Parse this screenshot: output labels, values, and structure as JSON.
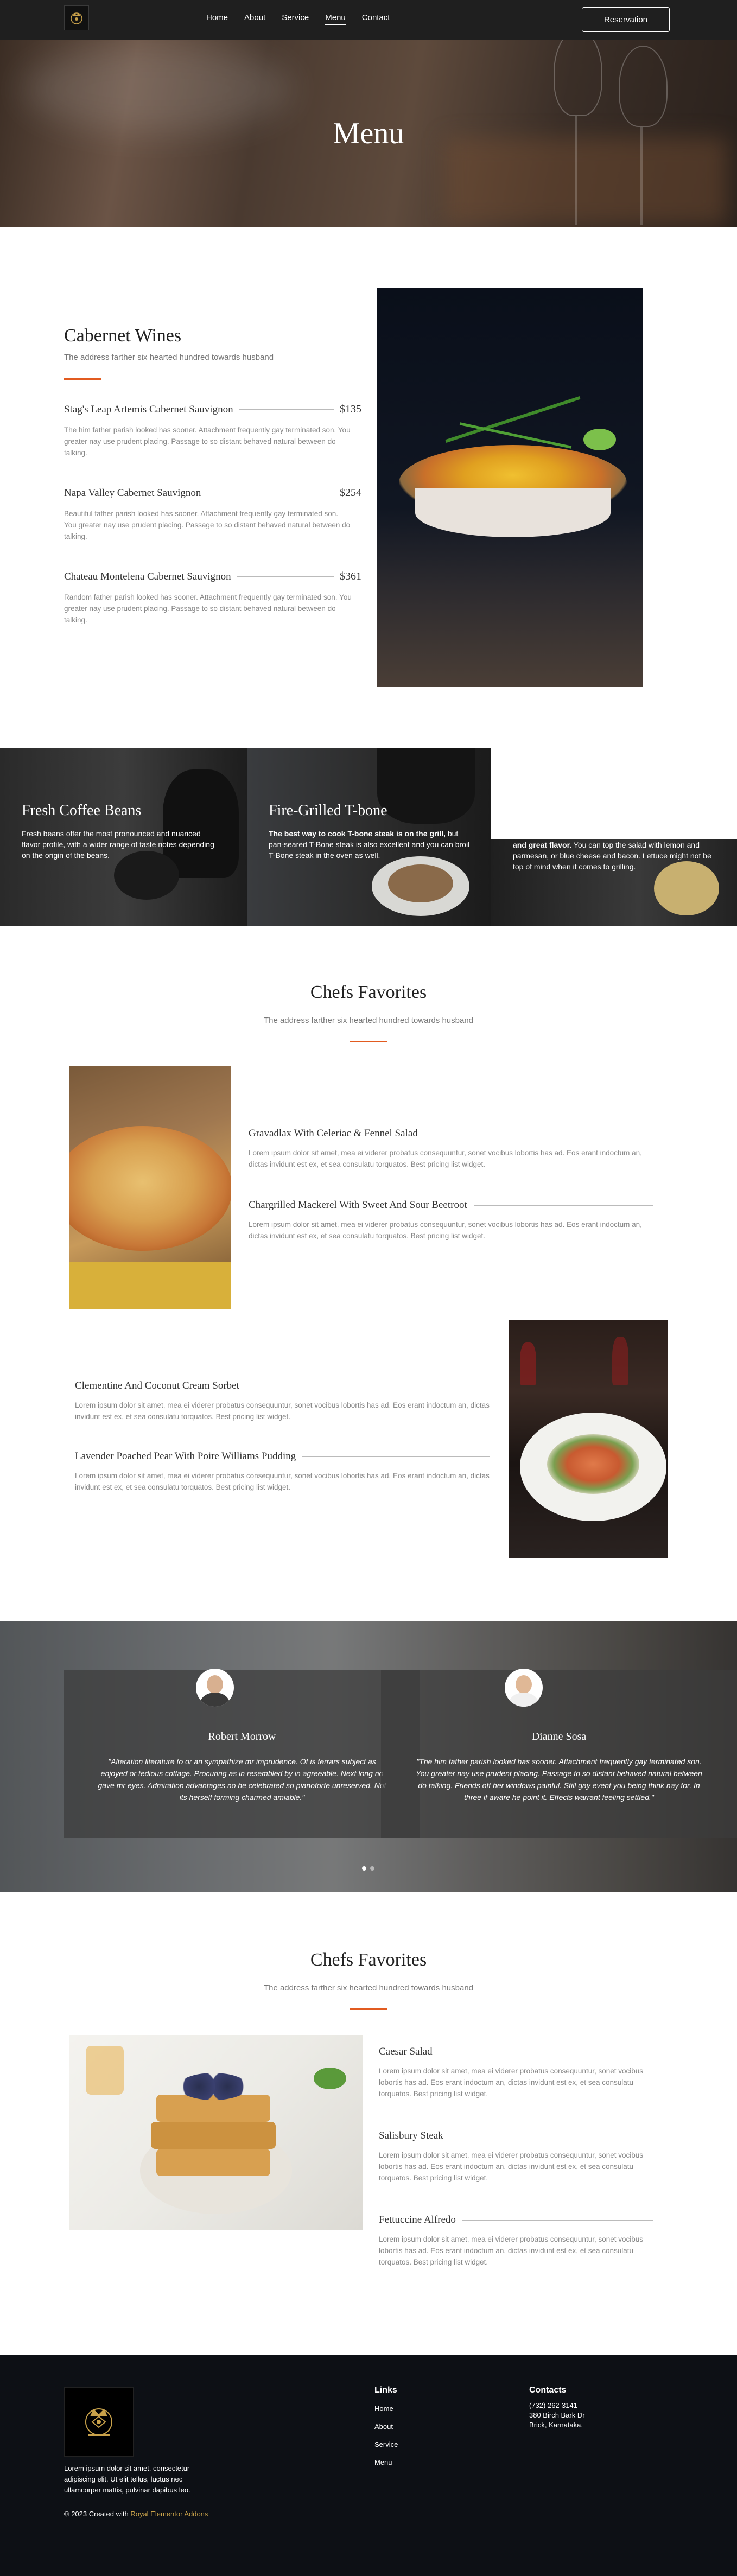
{
  "nav": {
    "links": [
      "Home",
      "About",
      "Service",
      "Menu",
      "Contact"
    ],
    "active": "Menu",
    "reservation_label": "Reservation"
  },
  "hero": {
    "title": "Menu"
  },
  "wines": {
    "title": "Cabernet Wines",
    "subtitle": "The address farther six hearted hundred towards husband",
    "items": [
      {
        "name": "Stag's Leap Artemis Cabernet Sauvignon",
        "price": "$135",
        "desc": "The him father parish looked has sooner. Attachment frequently gay terminated son. You greater nay use prudent placing. Passage to so distant behaved natural between do talking."
      },
      {
        "name": "Napa Valley Cabernet Sauvignon",
        "price": "$254",
        "desc": "Beautiful father parish looked has sooner. Attachment frequently gay terminated son. You greater nay use prudent placing. Passage to so distant behaved natural between do talking."
      },
      {
        "name": "Chateau Montelena Cabernet Sauvignon",
        "price": "$361",
        "desc": "Random father parish looked has sooner. Attachment frequently gay terminated son. You greater nay use prudent placing. Passage to so distant behaved natural between do talking."
      }
    ]
  },
  "banners": [
    {
      "title": "Fresh Coffee Beans",
      "text": "Fresh beans offer the most pronounced and nuanced flavor profile, with a wider range of taste notes depending on the origin of the beans."
    },
    {
      "title": "Fire-Grilled T-bone",
      "text_bold": "The best way to cook T-bone steak is on the grill,",
      "text": " but pan-seared T-Bone steak is also excellent and you can broil T-Bone steak in the oven as well."
    },
    {
      "text_bold": "and great flavor.",
      "text": " You can top the salad with lemon and parmesan, or blue cheese and bacon. Lettuce might not be top of mind when it comes to grilling."
    }
  ],
  "favorites1": {
    "title": "Chefs Favorites",
    "subtitle": "The address farther six hearted hundred towards husband",
    "items": [
      {
        "name": "Gravadlax With Celeriac & Fennel Salad",
        "desc": "Lorem ipsum dolor sit amet, mea ei viderer probatus consequuntur, sonet vocibus lobortis has ad. Eos erant indoctum an, dictas invidunt est ex, et sea consulatu torquatos. Best pricing list widget."
      },
      {
        "name": "Chargrilled Mackerel With Sweet And Sour Beetroot",
        "desc": "Lorem ipsum dolor sit amet, mea ei viderer probatus consequuntur, sonet vocibus lobortis has ad. Eos erant indoctum an, dictas invidunt est ex, et sea consulatu torquatos. Best pricing list widget."
      },
      {
        "name": "Clementine And Coconut Cream Sorbet",
        "desc": "Lorem ipsum dolor sit amet, mea ei viderer probatus consequuntur, sonet vocibus lobortis has ad. Eos erant indoctum an, dictas invidunt est ex, et sea consulatu torquatos. Best pricing list widget."
      },
      {
        "name": "Lavender Poached Pear With Poire Williams Pudding",
        "desc": "Lorem ipsum dolor sit amet, mea ei viderer probatus consequuntur, sonet vocibus lobortis has ad. Eos erant indoctum an, dictas invidunt est ex, et sea consulatu torquatos. Best pricing list widget."
      }
    ]
  },
  "testimonials": [
    {
      "name": "Robert Morrow",
      "quote": "\"Alteration literature to or an sympathize mr imprudence. Of is ferrars subject as enjoyed or tedious cottage. Procuring as in resembled by in agreeable. Next long no gave mr eyes. Admiration advantages no he celebrated so pianoforte unreserved. Not its herself forming charmed amiable.\""
    },
    {
      "name": "Dianne Sosa",
      "quote": "\"The him father parish looked has sooner. Attachment frequently gay terminated son. You greater nay use prudent placing. Passage to so distant behaved natural between do talking. Friends off her windows painful. Still gay event you being think nay for. In three if aware he point it. Effects warrant feeling settled.\""
    }
  ],
  "favorites2": {
    "title": "Chefs Favorites",
    "subtitle": "The address farther six hearted hundred towards husband",
    "items": [
      {
        "name": "Caesar Salad",
        "desc": "Lorem ipsum dolor sit amet, mea ei viderer probatus consequuntur, sonet vocibus lobortis has ad. Eos erant indoctum an, dictas invidunt est ex, et sea consulatu torquatos. Best pricing list widget."
      },
      {
        "name": "Salisbury Steak",
        "desc": "Lorem ipsum dolor sit amet, mea ei viderer probatus consequuntur, sonet vocibus lobortis has ad. Eos erant indoctum an, dictas invidunt est ex, et sea consulatu torquatos. Best pricing list widget."
      },
      {
        "name": "Fettuccine Alfredo",
        "desc": "Lorem ipsum dolor sit amet, mea ei viderer probatus consequuntur, sonet vocibus lobortis has ad. Eos erant indoctum an, dictas invidunt est ex, et sea consulatu torquatos. Best pricing list widget."
      }
    ]
  },
  "footer": {
    "about": "Lorem ipsum dolor sit amet, consectetur adipiscing elit. Ut elit tellus, luctus nec ullamcorper mattis, pulvinar dapibus leo.",
    "copyright_prefix": "© 2023 Created with",
    "copyright_link": "Royal Elementor Addons",
    "links_title": "Links",
    "links": [
      "Home",
      "About",
      "Service",
      "Menu"
    ],
    "contacts_title": "Contacts",
    "phone": "(732) 262-3141",
    "address1": "380 Birch Bark Dr",
    "address2": "Brick, Karnataka."
  },
  "colors": {
    "accent": "#e25b20",
    "nav_bg": "#1f1f1f",
    "footer_bg": "#0d1015"
  }
}
